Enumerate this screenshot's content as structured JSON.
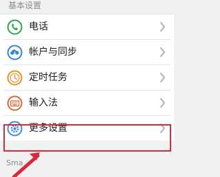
{
  "section": {
    "title": "基本设置"
  },
  "items": [
    {
      "label": "电话",
      "icon": "phone-icon",
      "color": "#2ea44f"
    },
    {
      "label": "帐户与同步",
      "icon": "cloud-sync-icon",
      "color": "#2f86d8"
    },
    {
      "label": "定时任务",
      "icon": "clock-icon",
      "color": "#e6932d"
    },
    {
      "label": "输入法",
      "icon": "keyboard-icon",
      "color": "#d06a34"
    },
    {
      "label": "更多设置",
      "icon": "gear-icon",
      "color": "#3c8ad8"
    }
  ],
  "next_section": {
    "partial_title": "Sma"
  },
  "annotation": {
    "highlight_color": "#d8283b"
  }
}
